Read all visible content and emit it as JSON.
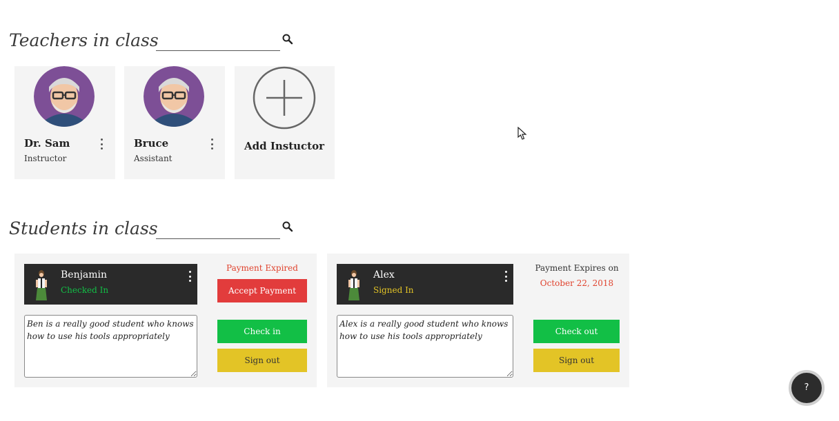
{
  "teachers": {
    "title": "Teachers in class",
    "items": [
      {
        "name": "Dr. Sam",
        "role": "Instructor"
      },
      {
        "name": "Bruce",
        "role": "Assistant"
      }
    ],
    "add_label": "Add Instuctor"
  },
  "students": {
    "title": "Students in class",
    "items": [
      {
        "name": "Benjamin",
        "status": "Checked In",
        "status_color": "#12bf46",
        "notes": "Ben is a really good student who knows how to use his tools appropriately",
        "payment_line1": "Payment Expired",
        "payment_color": "#e0432e",
        "accept_label": "Accept Payment",
        "check_label": "Check in",
        "sign_label": "Sign out"
      },
      {
        "name": "Alex",
        "status": "Signed In",
        "status_color": "#e3c426",
        "notes": "Alex is a really good student who knows how to use his tools appropriately",
        "payment_line1": "Payment Expires on",
        "payment_line2": "October 22, 2018",
        "payment_color": "#e0432e",
        "check_label": "Check out",
        "sign_label": "Sign out"
      }
    ]
  },
  "help": {
    "label": "?"
  }
}
